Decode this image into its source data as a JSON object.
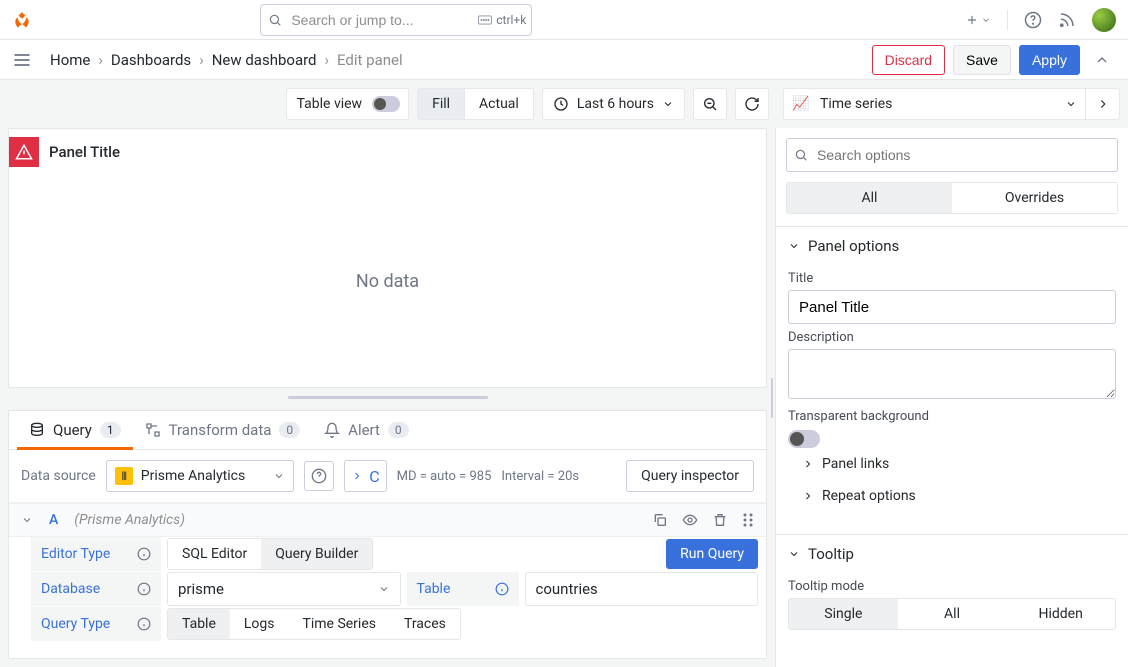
{
  "search": {
    "placeholder": "Search or jump to...",
    "shortcut": "ctrl+k"
  },
  "breadcrumbs": [
    "Home",
    "Dashboards",
    "New dashboard",
    "Edit panel"
  ],
  "actions": {
    "discard": "Discard",
    "save": "Save",
    "apply": "Apply"
  },
  "toolbar": {
    "tableview": "Table view",
    "fill": "Fill",
    "actual": "Actual",
    "timerange": "Last 6 hours",
    "viztype": "Time series"
  },
  "panel": {
    "title": "Panel Title",
    "nodata": "No data"
  },
  "tabs": {
    "query": "Query",
    "query_count": "1",
    "transform": "Transform data",
    "transform_count": "0",
    "alert": "Alert",
    "alert_count": "0"
  },
  "datasource": {
    "label": "Data source",
    "name": "Prisme Analytics",
    "md": "MD = auto = 985",
    "interval": "Interval = 20s",
    "inspector": "Query inspector"
  },
  "query": {
    "id": "A",
    "dsname": "(Prisme Analytics)",
    "editor_type_label": "Editor Type",
    "sql_editor": "SQL Editor",
    "query_builder": "Query Builder",
    "run": "Run Query",
    "database_label": "Database",
    "database_value": "prisme",
    "table_label": "Table",
    "table_value": "countries",
    "qtype_label": "Query Type",
    "qtype_table": "Table",
    "qtype_logs": "Logs",
    "qtype_ts": "Time Series",
    "qtype_traces": "Traces"
  },
  "options": {
    "search_placeholder": "Search options",
    "all": "All",
    "overrides": "Overrides",
    "panel_options": "Panel options",
    "title_label": "Title",
    "title_value": "Panel Title",
    "description_label": "Description",
    "transparent_label": "Transparent background",
    "panel_links": "Panel links",
    "repeat_options": "Repeat options",
    "tooltip": "Tooltip",
    "tooltip_mode": "Tooltip mode",
    "tm_single": "Single",
    "tm_all": "All",
    "tm_hidden": "Hidden"
  }
}
